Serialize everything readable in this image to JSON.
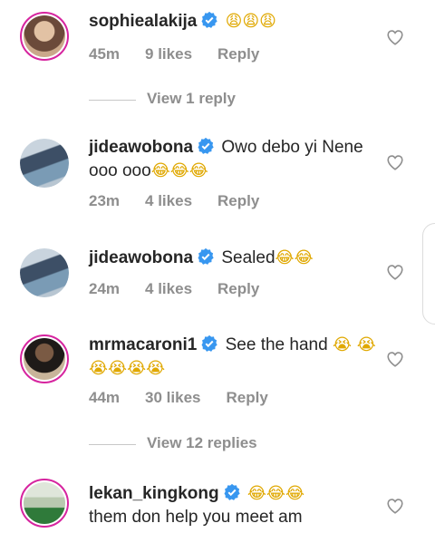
{
  "comments": [
    {
      "username": "sophiealakija",
      "text": "",
      "emoji": "😩😩😩",
      "time": "45m",
      "likes": "9 likes",
      "reply": "Reply",
      "avatar_colors": [
        "#caa88a",
        "#6b4a3a"
      ]
    },
    {
      "username": "jideawobona",
      "text": "Owo debo yi Nene ooo ooo",
      "emoji": "😂😂😂",
      "time": "23m",
      "likes": "4 likes",
      "reply": "Reply",
      "avatar_colors": [
        "#7a9bb5",
        "#3d4f66"
      ]
    },
    {
      "username": "jideawobona",
      "text": "Sealed",
      "emoji": "😂😂",
      "time": "24m",
      "likes": "4 likes",
      "reply": "Reply",
      "avatar_colors": [
        "#7a9bb5",
        "#3d4f66"
      ]
    },
    {
      "username": "mrmacaroni1",
      "text": "See the hand",
      "emoji": "😭 😭😭😭😭😭",
      "time": "44m",
      "likes": "30 likes",
      "reply": "Reply",
      "avatar_colors": [
        "#4a3a30",
        "#1e1a18"
      ]
    },
    {
      "username": "lekan_kingkong",
      "text": "",
      "emoji": "😂😂😂",
      "text2": "them don help you meet am",
      "avatar_colors": [
        "#b9c9b0",
        "#2f7a3a"
      ]
    }
  ],
  "view_replies": [
    "View 1 reply",
    "View 12 replies"
  ],
  "colors": {
    "verified": "#3897f0",
    "meta_gray": "#8e8e8e",
    "ring": "#d6249f"
  }
}
